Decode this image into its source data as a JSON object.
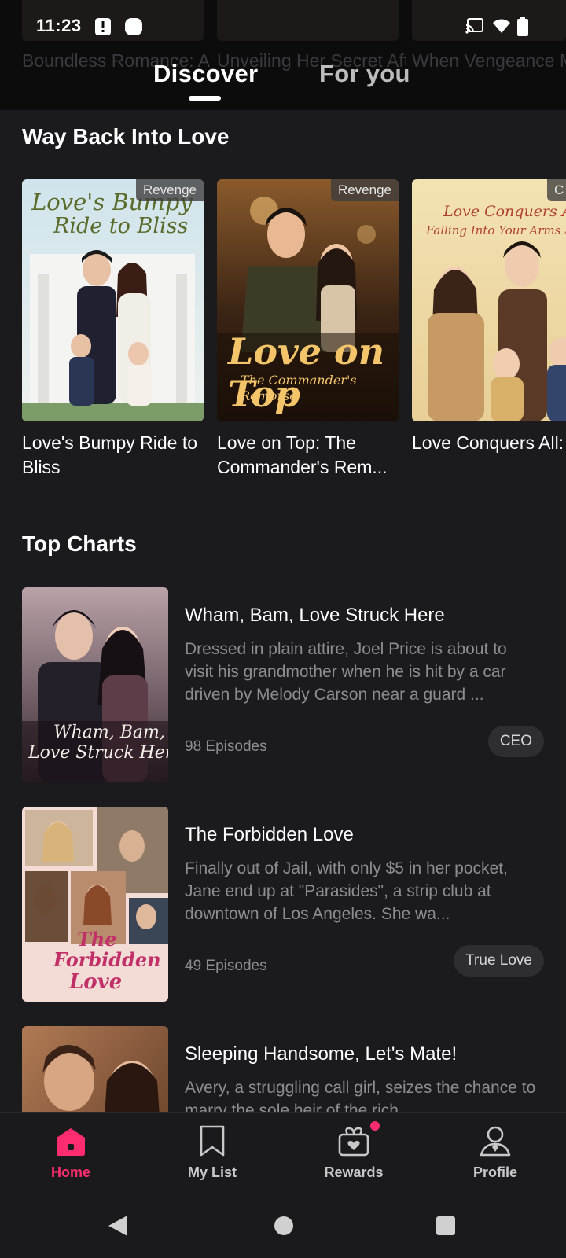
{
  "status_bar": {
    "time": "11:23"
  },
  "header": {
    "tabs": [
      {
        "label": "Discover",
        "active": true
      },
      {
        "label": "For you",
        "active": false
      }
    ],
    "background_titles": [
      "Boundless Romance: Allure B...",
      "Unveiling Her Secret After Divorce",
      "When Vengeance Meets Love"
    ]
  },
  "way_back": {
    "title": "Way Back Into Love",
    "cards": [
      {
        "title": "Love's Bumpy Ride to Bliss",
        "tag": "Revenge",
        "poster_text": "Love's Bumpy Ride to Bliss",
        "poster_text_a": "Love's Bumpy",
        "poster_text_b": "Ride to Bliss"
      },
      {
        "title": "Love on Top: The Commander's Rem...",
        "tag": "Revenge",
        "poster_text_a": "Love on Top",
        "poster_text_b": "The Commander's",
        "poster_text_c": "Remorse"
      },
      {
        "title": "Love Conquers All: Falling Into Your A",
        "tag": "C",
        "poster_text_a": "Love Conquers All:",
        "poster_text_b": "Falling Into Your Arms Ag"
      }
    ]
  },
  "top_charts": {
    "title": "Top Charts",
    "items": [
      {
        "title": "Wham, Bam, Love Struck Here",
        "description": "Dressed in plain attire, Joel Price is about to visit his grandmother when he is hit by a car driven by Melody Carson near a guard ...",
        "episodes": "98 Episodes",
        "tag": "CEO",
        "poster_text_a": "Wham, Bam,",
        "poster_text_b": "Love Struck Here"
      },
      {
        "title": "The Forbidden Love",
        "description": "Finally out of Jail, with only $5 in her pocket, Jane end up at \"Parasides\", a strip club at downtown of Los Angeles. She wa...",
        "episodes": "49 Episodes",
        "tag": "True Love",
        "poster_text_a": "The",
        "poster_text_b": "Forbidden",
        "poster_text_c": "Love"
      },
      {
        "title": "Sleeping Handsome, Let's Mate!",
        "description": "Avery, a struggling call girl, seizes the chance to marry the sole heir of the rich"
      }
    ]
  },
  "bottom_nav": [
    {
      "label": "Home",
      "icon": "home-icon",
      "active": true
    },
    {
      "label": "My List",
      "icon": "bookmark-icon",
      "active": false
    },
    {
      "label": "Rewards",
      "icon": "gift-icon",
      "active": false
    },
    {
      "label": "Profile",
      "icon": "profile-icon",
      "active": false
    }
  ],
  "colors": {
    "accent": "#ff2d6f",
    "background": "#1b1b1d",
    "header": "#0c0c0d"
  }
}
